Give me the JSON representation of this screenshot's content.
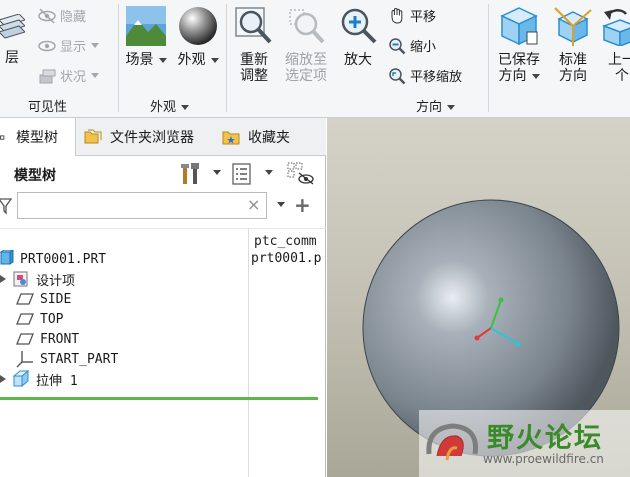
{
  "ribbon": {
    "visibility": {
      "layer_label": "层",
      "hide_label": "隐藏",
      "show_label": "显示",
      "status_label": "状况",
      "group_label": "可见性"
    },
    "appearance": {
      "scene_label": "场景",
      "appearance_label": "外观",
      "group_label": "外观"
    },
    "orientation": {
      "refit_label": "重新\n调整",
      "zoom_selected_label": "缩放至\n选定项",
      "zoom_in_label": "放大",
      "pan_label": "平移",
      "zoom_out_label": "缩小",
      "pan_zoom_label": "平移缩放",
      "saved_views_label": "已保存\n方向",
      "standard_label": "标准\n方向",
      "previous_label": "上一\n个",
      "group_label": "方向"
    }
  },
  "panel": {
    "tabs": [
      {
        "label": "模型树"
      },
      {
        "label": "文件夹浏览器"
      },
      {
        "label": "收藏夹"
      }
    ],
    "title": "模型树",
    "search": {
      "value": "",
      "clear": "×"
    },
    "column_header": "ptc_comm",
    "rows": [
      {
        "label": "PRT0001.PRT",
        "value": "prt0001.p"
      },
      {
        "label": "设计项"
      },
      {
        "label": "SIDE"
      },
      {
        "label": "TOP"
      },
      {
        "label": "FRONT"
      },
      {
        "label": "START_PART"
      },
      {
        "label": "拉伸 1"
      }
    ]
  },
  "watermark": {
    "name": "野火论坛",
    "url": "www.proewildfire.cn"
  },
  "colors": {
    "insert_line": "#5cb84a",
    "sphere": "#8e979f",
    "axis_x": "#e23b3b",
    "axis_y": "#3fbf3f",
    "axis_z": "#2bc4d8"
  }
}
